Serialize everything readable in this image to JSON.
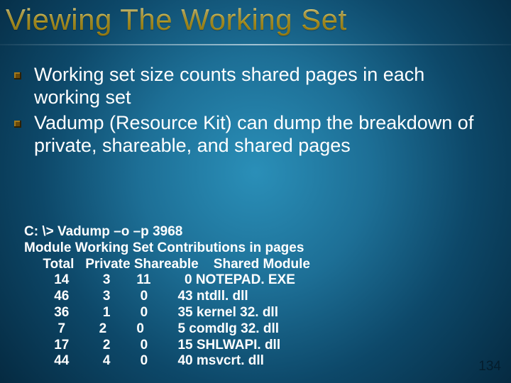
{
  "title": "Viewing The Working Set",
  "bullets": [
    "Working set size counts shared pages in each working set",
    "Vadump (Resource Kit) can dump the breakdown of private, shareable, and shared pages"
  ],
  "terminal": {
    "cmd": "C: \\> Vadump –o –p 3968",
    "header": "Module Working Set Contributions in pages",
    "cols": "     Total   Private Shareable    Shared Module",
    "rows": [
      "        14         3       11         0 NOTEPAD. EXE",
      "        46         3        0        43 ntdll. dll",
      "        36         1        0        35 kernel 32. dll",
      "         7         2        0         5 comdlg 32. dll",
      "        17         2        0        15 SHLWAPI. dll",
      "        44         4        0        40 msvcrt. dll"
    ]
  },
  "page_number": "134"
}
